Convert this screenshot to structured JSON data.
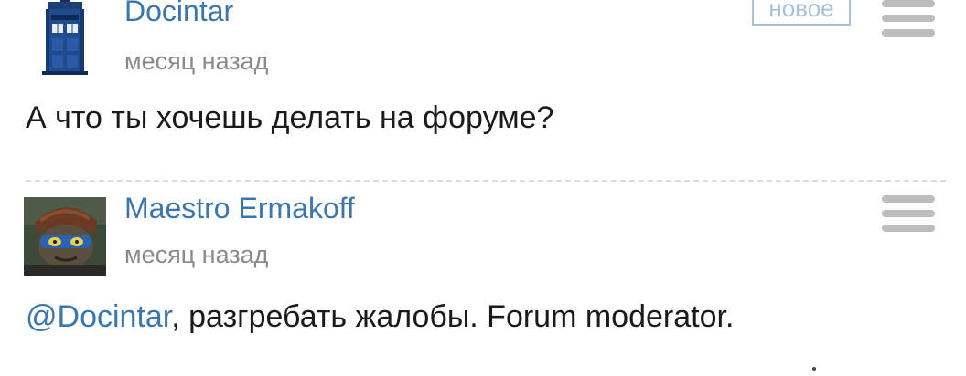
{
  "comments": [
    {
      "author": "Docintar",
      "time": "месяц назад",
      "badge": "новое",
      "text": "А что ты хочешь делать на форуме?"
    },
    {
      "author": "Maestro Ermakoff",
      "time": "месяц назад",
      "mention": "@Docintar",
      "text": ", разгребать жалобы. Forum moderator."
    }
  ]
}
